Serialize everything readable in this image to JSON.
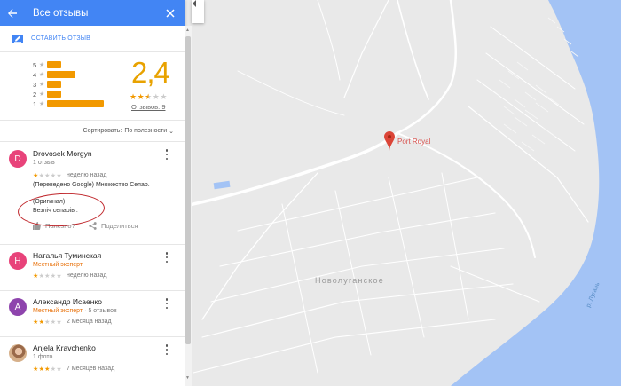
{
  "panel": {
    "title": "Все отзывы",
    "write_review": "ОСТАВИТЬ ОТЗЫВ"
  },
  "summary": {
    "rating": "2,4",
    "stars_filled": 2.5,
    "reviews_link": "Отзывов: 9",
    "histogram": [
      {
        "label": "5",
        "fraction": 0.25
      },
      {
        "label": "4",
        "fraction": 0.5
      },
      {
        "label": "3",
        "fraction": 0.25
      },
      {
        "label": "2",
        "fraction": 0.25
      },
      {
        "label": "1",
        "fraction": 1.0
      }
    ]
  },
  "sort": {
    "label": "Сортировать:",
    "value": "По полезности"
  },
  "reviews": [
    {
      "initial": "D",
      "avatar_color": "#e8437a",
      "name": "Drovosek Morgyn",
      "sub": "1 отзыв",
      "stars": 1,
      "time": "неделю назад",
      "translated": "(Переведено Google) Множество Сепар.",
      "original_label": "(Оригинал)",
      "original_text": "Безліч сепарів .",
      "helpful": "Полезно?",
      "share": "Поделиться"
    },
    {
      "initial": "Н",
      "avatar_color": "#e8437a",
      "name": "Наталья Туминская",
      "badge": "Местный эксперт",
      "stars": 1,
      "time": "неделю назад"
    },
    {
      "initial": "А",
      "avatar_color": "#8e44ad",
      "name": "Александр Исаенко",
      "badge": "Местный эксперт",
      "extra": "5 отзывов",
      "stars": 2,
      "time": "2 месяца назад"
    },
    {
      "name": "Anjela Kravchenko",
      "sub": "1 фото",
      "stars": 3,
      "time": "7 месяцев назад"
    }
  ],
  "map": {
    "place": "Port Royal",
    "town": "Новолуганское",
    "river": "р. Лугань",
    "colors": {
      "water": "#a3c3f5",
      "land": "#e9e9e9",
      "road": "#ffffff",
      "pin": "#db4437"
    }
  }
}
